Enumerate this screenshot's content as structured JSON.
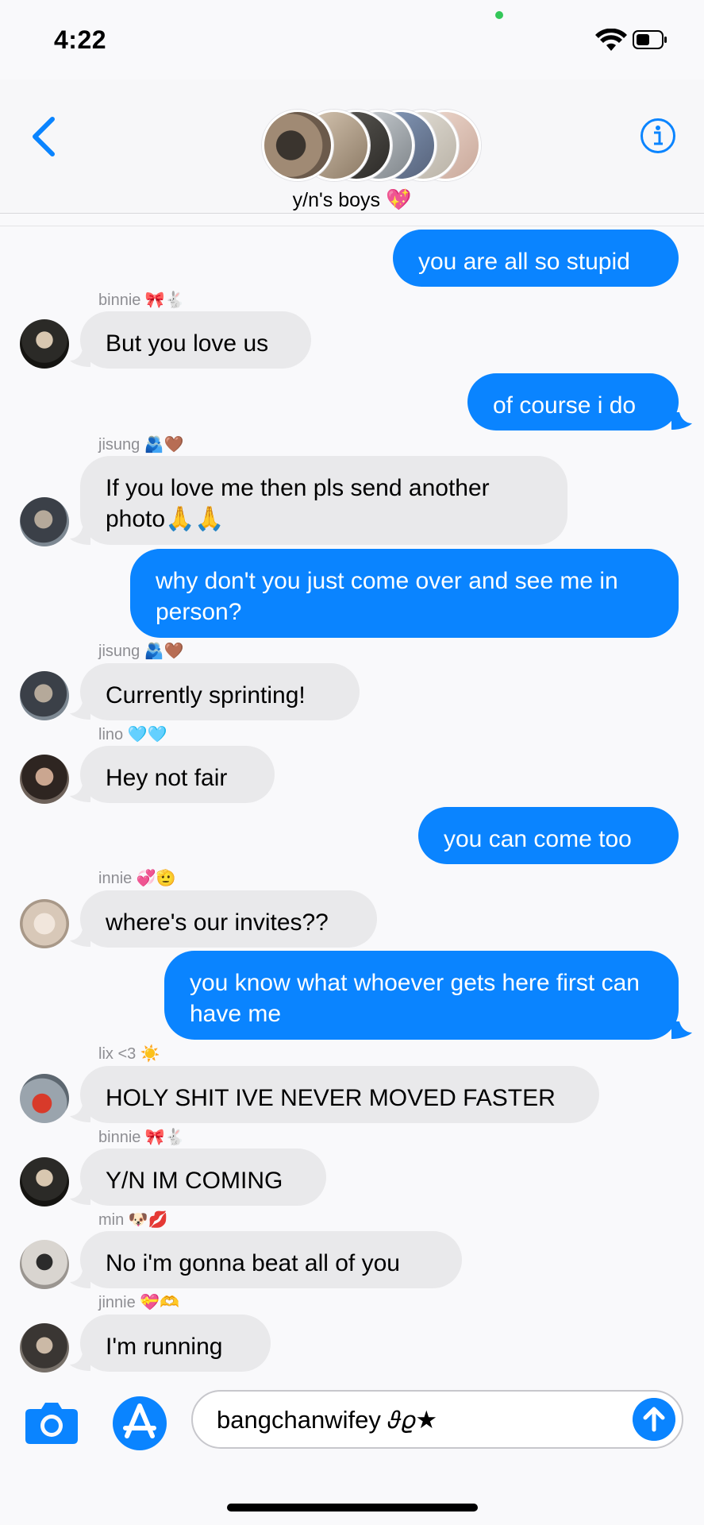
{
  "status_bar": {
    "time": "4:22"
  },
  "header": {
    "group_name": "y/n's boys",
    "group_emoji": "💖",
    "avatar_stack_icon": "group-avatar-stack"
  },
  "colors": {
    "accent": "#0a84ff",
    "incoming": "#e9e9eb",
    "outgoing": "#0a84ff",
    "sender": "#8e8e93"
  },
  "messages": [
    {
      "type": "out",
      "text": "you are all so stupid"
    },
    {
      "type": "in",
      "sender": "binnie 🎀🐇",
      "text": "But you love us"
    },
    {
      "type": "out",
      "text": "of course i do"
    },
    {
      "type": "in",
      "sender": "jisung 🫂🤎",
      "text": "If you love me then pls send another photo🙏🙏"
    },
    {
      "type": "out",
      "text": "why don't you just come over and see me in person?"
    },
    {
      "type": "in",
      "sender": "jisung 🫂🤎",
      "text": "Currently sprinting!"
    },
    {
      "type": "in",
      "sender": "lino 🩵🩵",
      "text": "Hey not fair"
    },
    {
      "type": "out",
      "text": "you can come too"
    },
    {
      "type": "in",
      "sender": "innie 💞🫡",
      "text": "where's our invites??"
    },
    {
      "type": "out",
      "text": "you know what whoever gets here first can have me"
    },
    {
      "type": "in",
      "sender": "lix <3 ☀️",
      "text": "HOLY SHIT IVE NEVER MOVED FASTER"
    },
    {
      "type": "in",
      "sender": "binnie 🎀🐇",
      "text": "Y/N IM COMING"
    },
    {
      "type": "in",
      "sender": "min 🐶💋",
      "text": "No i'm gonna beat all of you"
    },
    {
      "type": "in",
      "sender": "jinnie 💝🫶",
      "text": "I'm running"
    }
  ],
  "composer": {
    "input_value": "bangchanwifey 𝜗𝜚★",
    "camera_icon": "camera-icon",
    "apps_icon": "app-store-icon",
    "send_icon": "send-arrow-icon"
  }
}
